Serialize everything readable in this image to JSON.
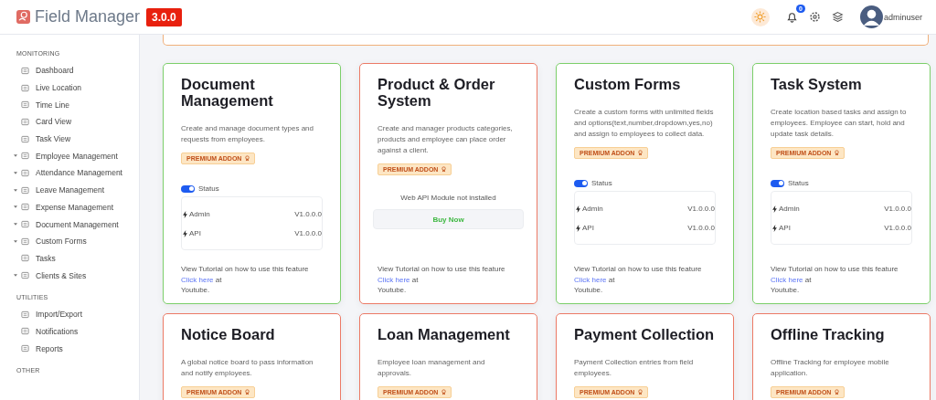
{
  "header": {
    "app_name": "Field Manager",
    "version": "3.0.0",
    "notification_count": "0",
    "username": "adminuser"
  },
  "sidebar": {
    "sections": [
      {
        "title": "MONITORING",
        "items": [
          {
            "label": "Dashboard",
            "expandable": false
          },
          {
            "label": "Live Location",
            "expandable": false
          },
          {
            "label": "Time Line",
            "expandable": false
          },
          {
            "label": "Card View",
            "expandable": false
          },
          {
            "label": "Task View",
            "expandable": false
          },
          {
            "label": "Employee Management",
            "expandable": true
          },
          {
            "label": "Attendance Management",
            "expandable": true
          },
          {
            "label": "Leave Management",
            "expandable": true
          },
          {
            "label": "Expense Management",
            "expandable": true
          },
          {
            "label": "Document Management",
            "expandable": true
          },
          {
            "label": "Custom Forms",
            "expandable": true
          },
          {
            "label": "Tasks",
            "expandable": false
          },
          {
            "label": "Clients & Sites",
            "expandable": true
          }
        ]
      },
      {
        "title": "UTILITIES",
        "items": [
          {
            "label": "Import/Export",
            "expandable": false
          },
          {
            "label": "Notifications",
            "expandable": false
          },
          {
            "label": "Reports",
            "expandable": false
          }
        ]
      },
      {
        "title": "OTHER"
      }
    ]
  },
  "addons": [
    {
      "title": "Document Management",
      "description": "Create and manage document types and requests from employees.",
      "badge": "PREMIUM ADDON",
      "installed": true,
      "status_label": "Status",
      "status_on": true,
      "modules": [
        {
          "name": "Admin",
          "version": "V1.0.0.0"
        },
        {
          "name": "API",
          "version": "V1.0.0.0"
        }
      ],
      "tutorial": "View Tutorial on how to use this feature",
      "link": "Click here",
      "link_suffix": "at",
      "platform": "Youtube."
    },
    {
      "title": "Product & Order System",
      "description": "Create and manager products categories, products and employee can place order against a client.",
      "badge": "PREMIUM ADDON",
      "installed": false,
      "message": "Web API Module not installed",
      "button": "Buy Now",
      "tutorial": "View Tutorial on how to use this feature",
      "link": "Click here",
      "link_suffix": "at",
      "platform": "Youtube."
    },
    {
      "title": "Custom Forms",
      "description": "Create a custom forms with unlimited fields and options(text,number,dropdown,yes,no) and assign to employees to collect data.",
      "badge": "PREMIUM ADDON",
      "installed": true,
      "status_label": "Status",
      "status_on": true,
      "modules": [
        {
          "name": "Admin",
          "version": "V1.0.0.0"
        },
        {
          "name": "API",
          "version": "V1.0.0.0"
        }
      ],
      "tutorial": "View Tutorial on how to use this feature",
      "link": "Click here",
      "link_suffix": "at",
      "platform": "Youtube."
    },
    {
      "title": "Task System",
      "description": "Create location based tasks and assign to employees. Employee can start, hold and update task details.",
      "badge": "PREMIUM ADDON",
      "installed": true,
      "status_label": "Status",
      "status_on": true,
      "modules": [
        {
          "name": "Admin",
          "version": "V1.0.0.0"
        },
        {
          "name": "API",
          "version": "V1.0.0.0"
        }
      ],
      "tutorial": "View Tutorial on how to use this feature",
      "link": "Click here",
      "link_suffix": "at",
      "platform": "Youtube."
    },
    {
      "title": "Notice Board",
      "description": "A global notice board to pass information and notify employees.",
      "badge": "PREMIUM ADDON",
      "installed": false
    },
    {
      "title": "Loan Management",
      "description": "Employee loan management and approvals.",
      "badge": "PREMIUM ADDON",
      "installed": false
    },
    {
      "title": "Payment Collection",
      "description": "Payment Collection entries from field employees.",
      "badge": "PREMIUM ADDON",
      "installed": false
    },
    {
      "title": "Offline Tracking",
      "description": "Offline Tracking for employee mobile application.",
      "badge": "PREMIUM ADDON",
      "installed": false
    }
  ]
}
